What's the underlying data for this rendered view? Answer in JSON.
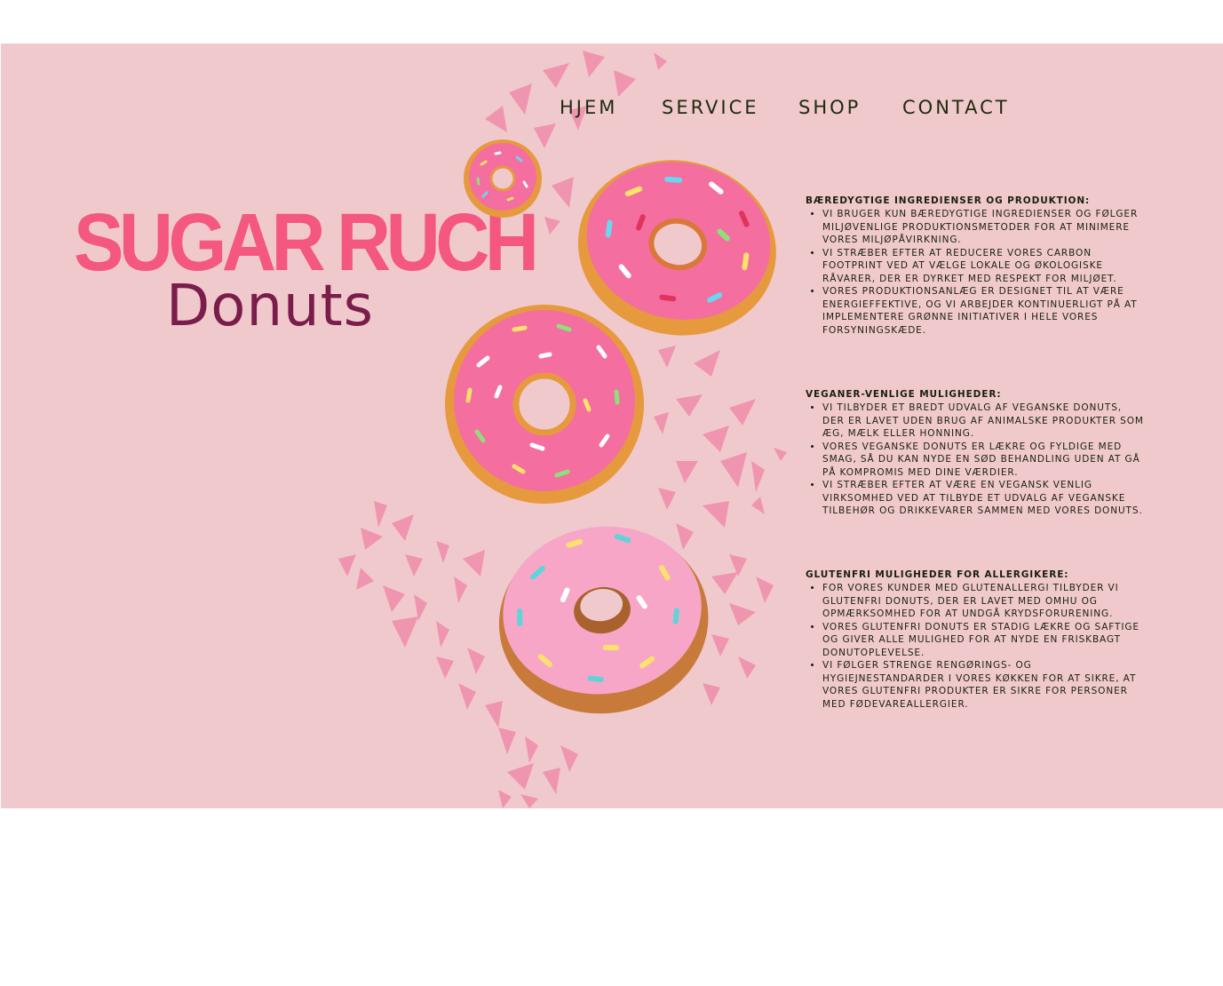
{
  "nav": {
    "items": [
      {
        "label": "HJEM"
      },
      {
        "label": "SERVICE"
      },
      {
        "label": "SHOP"
      },
      {
        "label": "CONTACT"
      }
    ]
  },
  "brand": {
    "title": "SUGAR RUCH",
    "subtitle": "Donuts"
  },
  "colors": {
    "background": "#f0c9cc",
    "brand_pink": "#f4577f",
    "brand_plum": "#7a1d4a",
    "text_dark": "#1f2a10",
    "confetti": "#f090ac",
    "frosting": "#f56ea0",
    "dough": "#e69a3d"
  },
  "sections": [
    {
      "heading": "Bæredygtige ingredienser og produktion:",
      "items": [
        "Vi bruger kun bæredygtige ingredienser og følger miljøvenlige produktionsmetoder for at minimere vores miljøpåvirkning.",
        "Vi stræber efter at reducere vores carbon footprint ved at vælge lokale og økologiske råvarer, der er dyrket med respekt for miljøet.",
        "Vores produktionsanlæg er designet til at være energieffektive, og vi arbejder kontinuerligt på at implementere grønne initiativer i hele vores forsyningskæde."
      ]
    },
    {
      "heading": "Veganer-venlige muligheder:",
      "items": [
        "Vi tilbyder et bredt udvalg af veganske donuts, der er lavet uden brug af animalske produkter som æg, mælk eller honning.",
        "Vores veganske donuts er lækre og fyldige med smag, så du kan nyde en sød behandling uden at gå på kompromis med dine værdier.",
        "Vi stræber efter at være en vegansk venlig virksomhed ved at tilbyde et udvalg af veganske tilbehør og drikkevarer sammen med vores donuts."
      ]
    },
    {
      "heading": "Glutenfri muligheder for allergikere:",
      "items": [
        "For vores kunder med glutenallergi tilbyder vi glutenfri donuts, der er lavet med omhu og opmærksomhed for at undgå krydsforurening.",
        "Vores glutenfri donuts er stadig lækre og saftige og giver alle mulighed for at nyde en friskbagt donutoplevelse.",
        "Vi følger strenge rengørings- og hygiejnestandarder i vores køkken for at sikre, at vores glutenfri produkter er sikre for personer med fødevareallergier."
      ]
    }
  ]
}
